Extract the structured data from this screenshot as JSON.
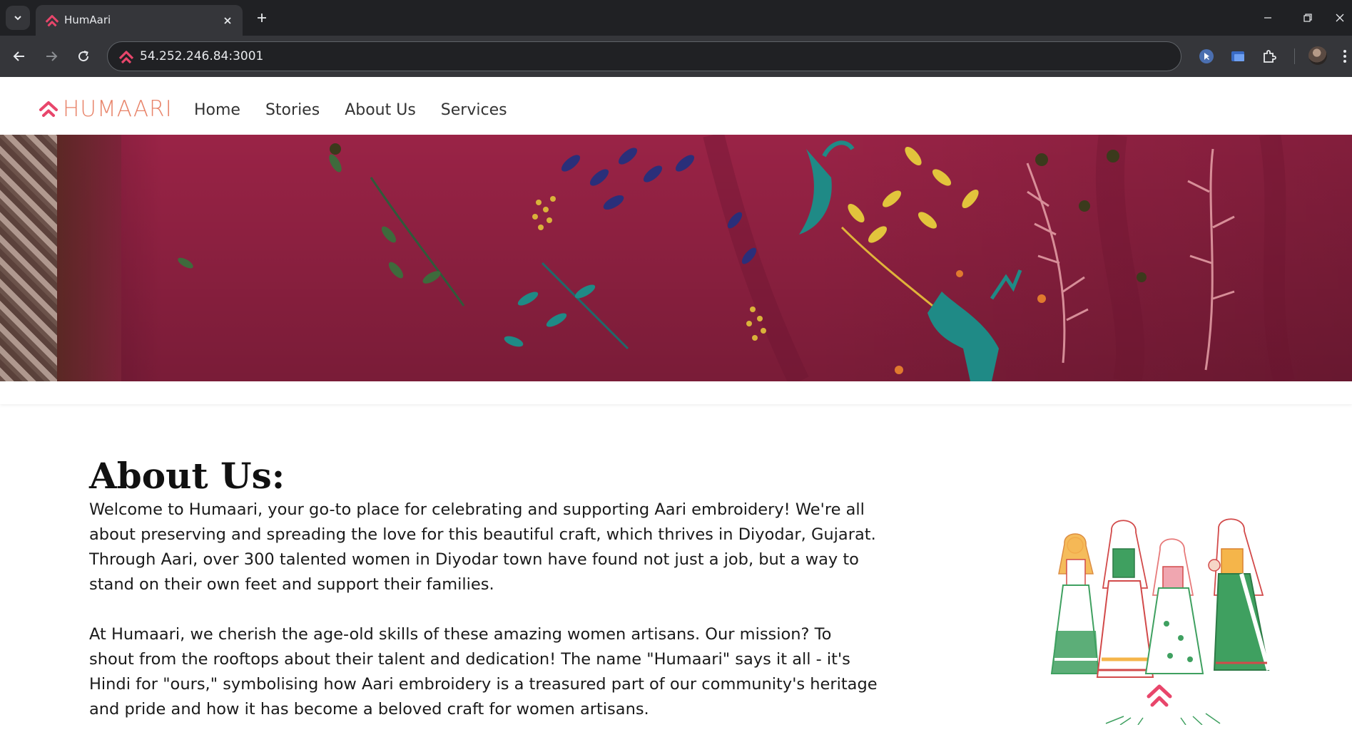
{
  "browser": {
    "tab_title": "HumAari",
    "url": "54.252.246.84:3001",
    "accent_color": "#e8466b"
  },
  "site": {
    "logo_text": "HUMAARI",
    "nav": [
      {
        "label": "Home"
      },
      {
        "label": "Stories"
      },
      {
        "label": "About Us"
      },
      {
        "label": "Services"
      }
    ]
  },
  "about": {
    "title": "About Us:",
    "paragraphs": [
      "Welcome to Humaari, your go-to place for celebrating and supporting Aari embroidery! We're all about preserving and spreading the love for this beautiful craft, which thrives in Diyodar, Gujarat. Through Aari, over 300 talented women in Diyodar town have found not just a job, but a way to stand on their own feet and support their families.",
      "At Humaari, we cherish the age-old skills of these amazing women artisans. Our mission? To shout from the rooftops about their talent and dedication! The name \"Humaari\" says it all - it's Hindi for \"ours,\" symbolising how Aari embroidery is a treasured part of our community's heritage and pride and how it has become a beloved craft for women artisans."
    ]
  }
}
